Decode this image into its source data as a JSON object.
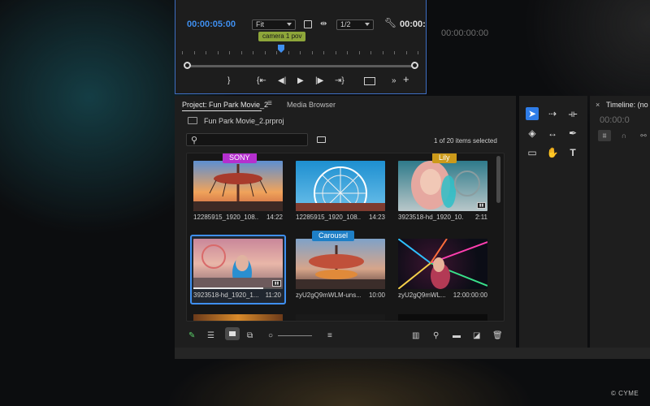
{
  "program_monitor": {
    "timecode": "00:00:05:00",
    "fit_value": "Fit",
    "resolution_value": "1/2",
    "right_timecode": "00:00:",
    "marker_label": "camera 1 pov"
  },
  "source_monitor": {
    "timecode": "00:00:00:00"
  },
  "project_panel": {
    "tab_label": "Project: Fun Park Movie_2",
    "media_browser_label": "Media Browser",
    "bin_name": "Fun Park Movie_2.prproj",
    "search_placeholder": "",
    "selection_status": "1 of 20 items selected",
    "clips": [
      {
        "name": "12285915_1920_108...",
        "duration": "14:22",
        "label": "SONY",
        "label_color": "#b52fcf"
      },
      {
        "name": "12285915_1920_108...",
        "duration": "14:23",
        "label": "",
        "label_color": ""
      },
      {
        "name": "3923518-hd_1920_10...",
        "duration": "2:11",
        "label": "Lily",
        "label_color": "#cc9a1a"
      },
      {
        "name": "3923518-hd_1920_1...",
        "duration": "11:20",
        "label": "",
        "label_color": ""
      },
      {
        "name": "zyU2gQ9mWLM-uns...",
        "duration": "10:00",
        "label": "Carousel",
        "label_color": "#1e7fc6"
      },
      {
        "name": "zyU2gQ9mWL...",
        "duration": "12:00:00:00",
        "label": "",
        "label_color": ""
      }
    ],
    "selected_clip_progress": 0.78
  },
  "timeline": {
    "close_glyph": "×",
    "title": "Timeline: (no s",
    "timecode": "00:00:0"
  },
  "watermark": "© CYME",
  "accent_color": "#3f8ff0"
}
